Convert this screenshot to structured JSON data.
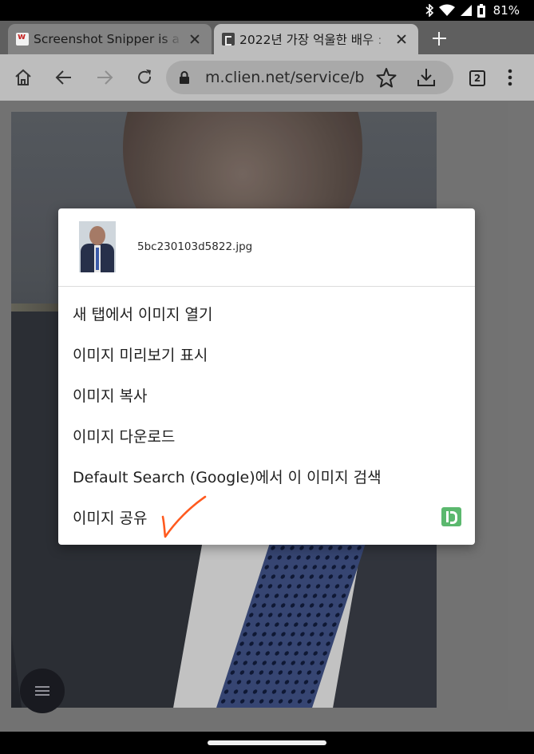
{
  "status_bar": {
    "icons": [
      "bluetooth-icon",
      "wifi-icon",
      "signal-icon",
      "battery-icon"
    ],
    "battery_percent": "81%"
  },
  "tabs": [
    {
      "title": "Screenshot Snipper is a f",
      "favicon": "screenshot-snipper-favicon",
      "active": false
    },
    {
      "title": "2022년 가장 억울한 배우 :",
      "favicon": "clien-favicon",
      "active": true
    }
  ],
  "toolbar": {
    "icons": [
      "home-icon",
      "back-arrow-icon",
      "forward-arrow-icon",
      "reload-icon",
      "lock-icon",
      "star-icon",
      "download-icon",
      "menu-kebab-icon"
    ],
    "url": "m.clien.net/service/boa",
    "tab_count": "2"
  },
  "context_menu": {
    "filename": "5bc230103d5822.jpg",
    "items": [
      {
        "label": "새 탭에서 이미지 열기"
      },
      {
        "label": "이미지 미리보기 표시"
      },
      {
        "label": "이미지 복사"
      },
      {
        "label": "이미지 다운로드"
      },
      {
        "label": "Default Search (Google)에서 이 이미지 검색"
      },
      {
        "label": "이미지 공유",
        "badge_icon": "pushbullet-share-icon"
      }
    ]
  },
  "annotation": {
    "mark": "handwritten-checkmark",
    "color": "#ff5a1f"
  },
  "colors": {
    "tab_strip": "#5f5f5f",
    "active_tab": "#bdbdbd",
    "inactive_tab": "#838383",
    "toolbar": "#bdbdbd",
    "omnibox": "#a9a9a9",
    "share_badge": "#5bb86e"
  }
}
